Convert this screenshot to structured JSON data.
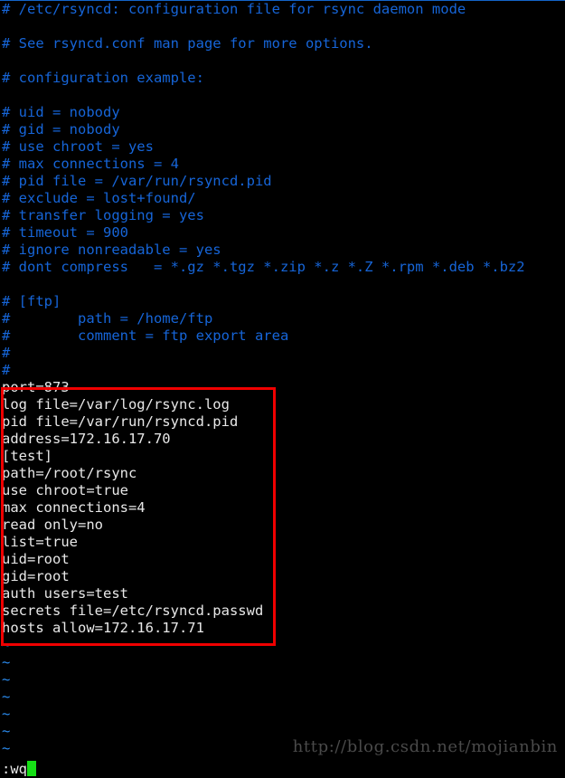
{
  "app": {
    "name": "vim",
    "filename": "/etc/rsyncd.conf",
    "background": "#000000",
    "comment_color": "#1665d8",
    "text_color": "#e8e8e8",
    "tilde_color": "#2b8cf0",
    "highlight_color": "#f00000",
    "cursor_color": "#16e016"
  },
  "buffer": {
    "lines": [
      {
        "kind": "comment",
        "text": "# /etc/rsyncd: configuration file for rsync daemon mode"
      },
      {
        "kind": "blank",
        "text": ""
      },
      {
        "kind": "comment",
        "text": "# See rsyncd.conf man page for more options."
      },
      {
        "kind": "blank",
        "text": ""
      },
      {
        "kind": "comment",
        "text": "# configuration example:"
      },
      {
        "kind": "blank",
        "text": ""
      },
      {
        "kind": "comment",
        "text": "# uid = nobody"
      },
      {
        "kind": "comment",
        "text": "# gid = nobody"
      },
      {
        "kind": "comment",
        "text": "# use chroot = yes"
      },
      {
        "kind": "comment",
        "text": "# max connections = 4"
      },
      {
        "kind": "comment",
        "text": "# pid file = /var/run/rsyncd.pid"
      },
      {
        "kind": "comment",
        "text": "# exclude = lost+found/"
      },
      {
        "kind": "comment",
        "text": "# transfer logging = yes"
      },
      {
        "kind": "comment",
        "text": "# timeout = 900"
      },
      {
        "kind": "comment",
        "text": "# ignore nonreadable = yes"
      },
      {
        "kind": "comment",
        "text": "# dont compress   = *.gz *.tgz *.zip *.z *.Z *.rpm *.deb *.bz2"
      },
      {
        "kind": "blank",
        "text": ""
      },
      {
        "kind": "comment",
        "text": "# [ftp]"
      },
      {
        "kind": "comment",
        "text": "#        path = /home/ftp"
      },
      {
        "kind": "comment",
        "text": "#        comment = ftp export area"
      },
      {
        "kind": "comment",
        "text": "#"
      },
      {
        "kind": "comment",
        "text": "#"
      },
      {
        "kind": "conf",
        "text": "port=873"
      },
      {
        "kind": "conf",
        "text": "log file=/var/log/rsync.log"
      },
      {
        "kind": "conf",
        "text": "pid file=/var/run/rsyncd.pid"
      },
      {
        "kind": "conf",
        "text": "address=172.16.17.70"
      },
      {
        "kind": "conf",
        "text": "[test]"
      },
      {
        "kind": "conf",
        "text": "path=/root/rsync"
      },
      {
        "kind": "conf",
        "text": "use chroot=true"
      },
      {
        "kind": "conf",
        "text": "max connections=4"
      },
      {
        "kind": "conf",
        "text": "read only=no"
      },
      {
        "kind": "conf",
        "text": "list=true"
      },
      {
        "kind": "conf",
        "text": "uid=root"
      },
      {
        "kind": "conf",
        "text": "gid=root"
      },
      {
        "kind": "conf",
        "text": "auth users=test"
      },
      {
        "kind": "conf",
        "text": "secrets file=/etc/rsyncd.passwd"
      },
      {
        "kind": "conf",
        "text": "hosts allow=172.16.17.71"
      },
      {
        "kind": "tilde",
        "text": "~"
      },
      {
        "kind": "tilde",
        "text": "~"
      },
      {
        "kind": "tilde",
        "text": "~"
      },
      {
        "kind": "tilde",
        "text": "~"
      },
      {
        "kind": "tilde",
        "text": "~"
      },
      {
        "kind": "tilde",
        "text": "~"
      },
      {
        "kind": "tilde",
        "text": "~"
      }
    ]
  },
  "highlight": {
    "label": "active-config-block",
    "first_line": "port=873",
    "last_line": "hosts allow=172.16.17.71"
  },
  "status": {
    "command": ":wq"
  },
  "watermark": {
    "text": "http://blog.csdn.net/mojianbin"
  }
}
